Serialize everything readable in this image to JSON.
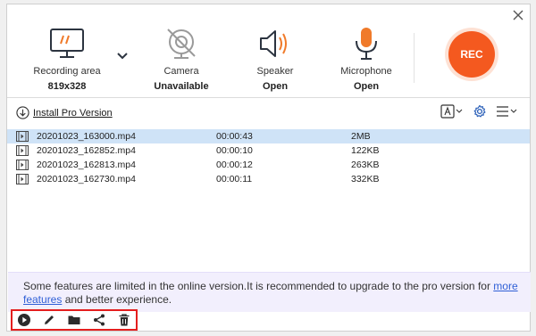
{
  "controls": {
    "recording_area": {
      "label": "Recording area",
      "value": "819x328"
    },
    "camera": {
      "label": "Camera",
      "value": "Unavailable"
    },
    "speaker": {
      "label": "Speaker",
      "value": "Open"
    },
    "microphone": {
      "label": "Microphone",
      "value": "Open"
    },
    "rec_label": "REC"
  },
  "toolbar": {
    "install_label": "Install Pro Version"
  },
  "files": [
    {
      "name": "20201023_163000.mp4",
      "duration": "00:00:43",
      "size": "2MB",
      "selected": true
    },
    {
      "name": "20201023_162852.mp4",
      "duration": "00:00:10",
      "size": "122KB",
      "selected": false
    },
    {
      "name": "20201023_162813.mp4",
      "duration": "00:00:12",
      "size": "263KB",
      "selected": false
    },
    {
      "name": "20201023_162730.mp4",
      "duration": "00:00:11",
      "size": "332KB",
      "selected": false
    }
  ],
  "banner": {
    "text_before": "Some features are limited in the online version.It is recommended to upgrade to the pro version for ",
    "link": "more features",
    "text_after": " and better experience."
  },
  "colors": {
    "rec": "#f4591f",
    "accent_orange": "#f07a2a",
    "selection": "#cfe3f7",
    "banner_bg": "#f2effd",
    "link": "#2f5fd6",
    "highlight_border": "#e41e1e"
  },
  "icons": {
    "recording_area": "monitor-icon",
    "camera": "camera-off-icon",
    "speaker": "speaker-icon",
    "microphone": "microphone-icon",
    "actions": [
      "play-icon",
      "edit-icon",
      "folder-icon",
      "share-icon",
      "trash-icon"
    ]
  }
}
